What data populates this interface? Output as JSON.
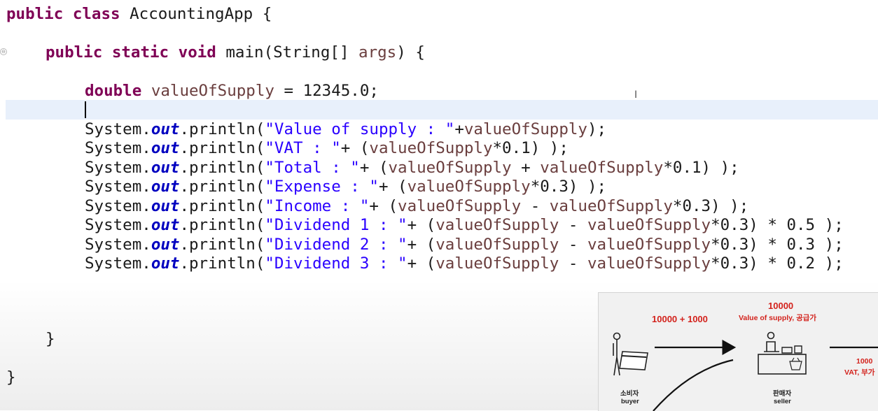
{
  "editor": {
    "lines": [
      {
        "kw1": "public class",
        "name": " AccountingApp {"
      },
      {
        "kw1": "public static void",
        "name": " main(String[] ",
        "param": "args",
        "end": ") {"
      },
      {
        "kw1": "double",
        "var": " valueOfSupply",
        "rest": " = 12345.0;"
      },
      {
        "obj": "System.",
        "fld": "out",
        "call": ".println(",
        "str": "\"Value of supply : \"",
        "plus": "+",
        "var": "valueOfSupply",
        "end": ");"
      },
      {
        "obj": "System.",
        "fld": "out",
        "call": ".println(",
        "str": "\"VAT : \"",
        "plus": "+ (",
        "var": "valueOfSupply",
        "end": "*0.1) );"
      },
      {
        "obj": "System.",
        "fld": "out",
        "call": ".println(",
        "str": "\"Total : \"",
        "plus": "+ (",
        "var": "valueOfSupply",
        "mid": " + ",
        "var2": "valueOfSupply",
        "end": "*0.1) );"
      },
      {
        "obj": "System.",
        "fld": "out",
        "call": ".println(",
        "str": "\"Expense : \"",
        "plus": "+ (",
        "var": "valueOfSupply",
        "end": "*0.3) );"
      },
      {
        "obj": "System.",
        "fld": "out",
        "call": ".println(",
        "str": "\"Income : \"",
        "plus": "+ (",
        "var": "valueOfSupply",
        "mid": " - ",
        "var2": "valueOfSupply",
        "end": "*0.3) );"
      },
      {
        "obj": "System.",
        "fld": "out",
        "call": ".println(",
        "str": "\"Dividend 1 : \"",
        "plus": "+ (",
        "var": "valueOfSupply",
        "mid": " - ",
        "var2": "valueOfSupply",
        "end": "*0.3) * 0.5 );"
      },
      {
        "obj": "System.",
        "fld": "out",
        "call": ".println(",
        "str": "\"Dividend 2 : \"",
        "plus": "+ (",
        "var": "valueOfSupply",
        "mid": " - ",
        "var2": "valueOfSupply",
        "end": "*0.3) * 0.3 );"
      },
      {
        "obj": "System.",
        "fld": "out",
        "call": ".println(",
        "str": "\"Dividend 3 : \"",
        "plus": "+ (",
        "var": "valueOfSupply",
        "mid": " - ",
        "var2": "valueOfSupply",
        "end": "*0.3) * 0.2 );"
      },
      {
        "text": "}"
      },
      {
        "text": "}"
      }
    ],
    "fold_marker": "⊖",
    "ibeam": "I"
  },
  "diagram": {
    "payment_label": "10000 + 1000",
    "value_label": "10000",
    "value_caption": "Value of supply, 공급가",
    "vat_amount": "1000",
    "vat_label": "VAT, 부가",
    "buyer_ko": "소비자",
    "buyer_en": "buyer",
    "seller_ko": "판매자",
    "seller_en": "seller",
    "icons": [
      "buyer-with-card-icon",
      "seller-counter-icon",
      "arrow-right-icon",
      "curved-arrow-icon"
    ]
  }
}
